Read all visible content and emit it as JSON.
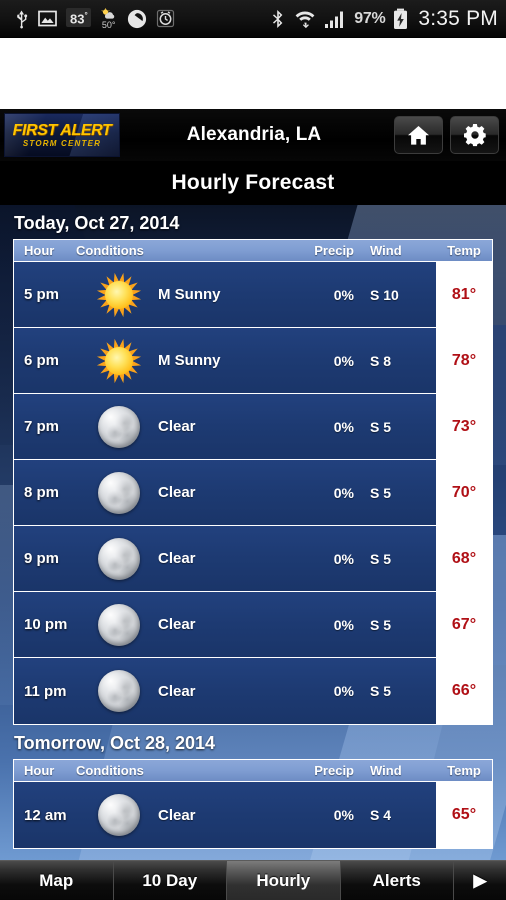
{
  "statusbar": {
    "icons": [
      "usb-icon",
      "gallery-icon",
      "temperature-badge",
      "weather-icon",
      "media-play-icon",
      "alarm-icon",
      "bluetooth-icon",
      "wifi-icon",
      "signal-icon"
    ],
    "temp_badge": "83",
    "temp_badge_unit": "°",
    "weather_temp": "50°",
    "battery_percent": "97%",
    "clock": "3:35 PM"
  },
  "appbar": {
    "logo_line1": "FIRST ALERT",
    "logo_line2": "STORM CENTER",
    "city": "Alexandria, LA",
    "home_button": "home-icon",
    "settings_button": "gear-icon"
  },
  "title": "Hourly Forecast",
  "columns": {
    "hour": "Hour",
    "conditions": "Conditions",
    "precip": "Precip",
    "wind": "Wind",
    "temp": "Temp"
  },
  "colors": {
    "accent_gold": "#ffc400",
    "temp_red": "#b01016",
    "row_blue": "#1d3a72",
    "header_blue": "#7f9dd2"
  },
  "sections": [
    {
      "title": "Today, Oct 27, 2014",
      "rows": [
        {
          "hour": "5 pm",
          "icon": "sun-icon",
          "conditions": "M Sunny",
          "precip": "0%",
          "wind": "S 10",
          "temp": "81°"
        },
        {
          "hour": "6 pm",
          "icon": "sun-icon",
          "conditions": "M Sunny",
          "precip": "0%",
          "wind": "S 8",
          "temp": "78°"
        },
        {
          "hour": "7 pm",
          "icon": "moon-icon",
          "conditions": "Clear",
          "precip": "0%",
          "wind": "S 5",
          "temp": "73°"
        },
        {
          "hour": "8 pm",
          "icon": "moon-icon",
          "conditions": "Clear",
          "precip": "0%",
          "wind": "S 5",
          "temp": "70°"
        },
        {
          "hour": "9 pm",
          "icon": "moon-icon",
          "conditions": "Clear",
          "precip": "0%",
          "wind": "S 5",
          "temp": "68°"
        },
        {
          "hour": "10 pm",
          "icon": "moon-icon",
          "conditions": "Clear",
          "precip": "0%",
          "wind": "S 5",
          "temp": "67°"
        },
        {
          "hour": "11 pm",
          "icon": "moon-icon",
          "conditions": "Clear",
          "precip": "0%",
          "wind": "S 5",
          "temp": "66°"
        }
      ]
    },
    {
      "title": "Tomorrow, Oct 28, 2014",
      "rows": [
        {
          "hour": "12 am",
          "icon": "moon-icon",
          "conditions": "Clear",
          "precip": "0%",
          "wind": "S 4",
          "temp": "65°"
        }
      ]
    }
  ],
  "tabs": [
    {
      "label": "Map",
      "active": false
    },
    {
      "label": "10 Day",
      "active": false
    },
    {
      "label": "Hourly",
      "active": true
    },
    {
      "label": "Alerts",
      "active": false
    },
    {
      "label": "▶",
      "active": false,
      "arrow": true
    }
  ]
}
